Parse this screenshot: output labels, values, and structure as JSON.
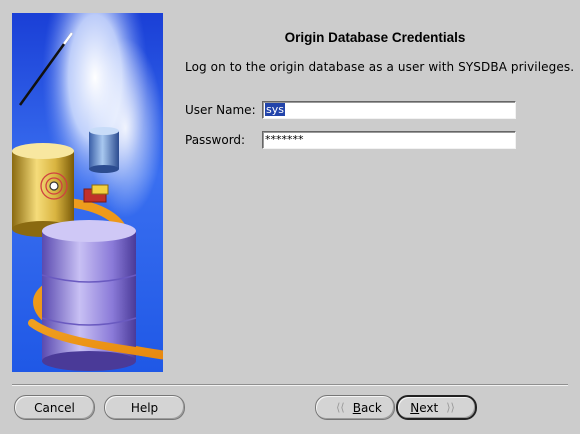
{
  "wizard": {
    "title": "Origin Database Credentials",
    "instruction": "Log on to the origin database as a user with SYSDBA privileges."
  },
  "form": {
    "username_label": "User Name:",
    "username_value": "sys",
    "password_label": "Password:",
    "password_value": "*******"
  },
  "buttons": {
    "cancel": "Cancel",
    "help": "Help",
    "back_mnemonic": "B",
    "back_rest": "ack",
    "next_mnemonic": "N",
    "next_rest": "ext"
  },
  "icons": {
    "back": "chevron-left-icon",
    "next": "chevron-right-icon"
  },
  "colors": {
    "background": "#cccccc",
    "selection": "#2244aa"
  }
}
